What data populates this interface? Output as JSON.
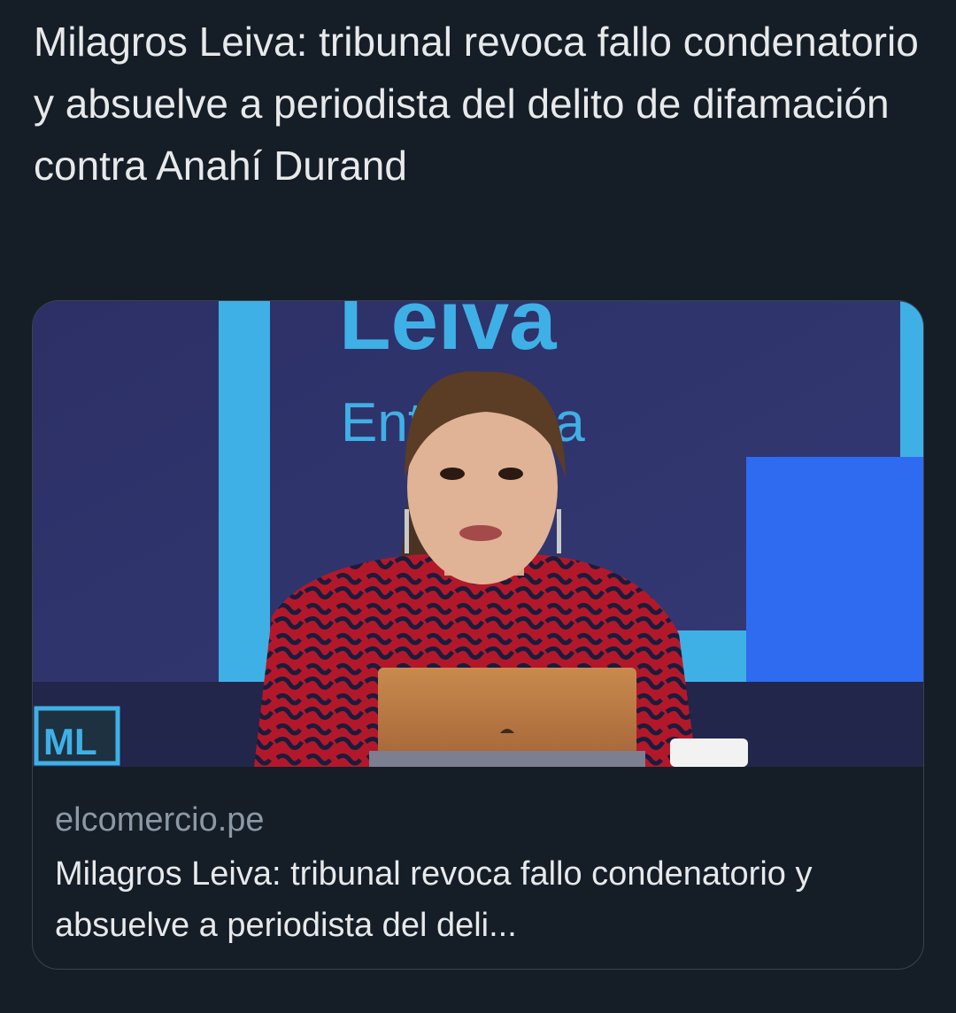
{
  "tweet": {
    "text": "Milagros Leiva: tribunal revoca fallo condenatorio y absuelve a periodista del delito de difamación contra Anahí Durand"
  },
  "card": {
    "image": {
      "banner_name": "Leiva",
      "banner_subtitle": "Entrevista",
      "logo": "ML"
    },
    "domain": "elcomercio.pe",
    "title": "Milagros Leiva: tribunal revoca fallo condenatorio y absuelve a periodista del deli..."
  },
  "colors": {
    "background": "#151d27",
    "text": "#e7e9ea",
    "secondary_text": "#8b98a5",
    "card_border": "#38444d",
    "studio_blue": "#2f3569",
    "accent_cyan": "#3fb0e6",
    "accent_blue": "#2f6bf0"
  }
}
